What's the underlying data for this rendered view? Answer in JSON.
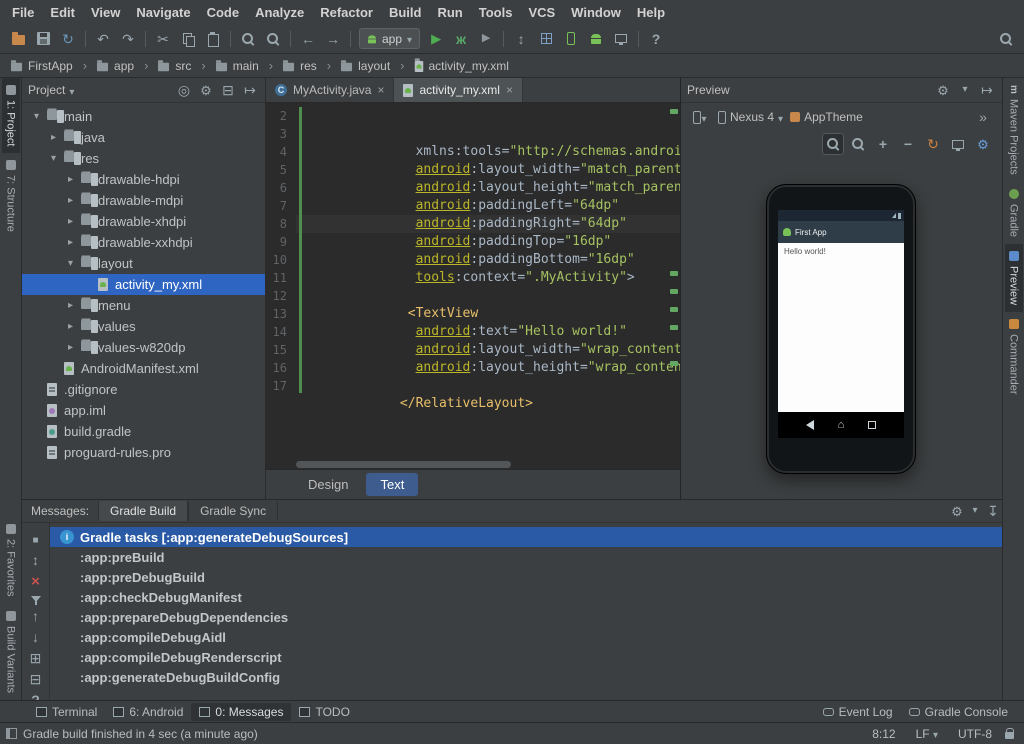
{
  "menubar": {
    "items": [
      "File",
      "Edit",
      "View",
      "Navigate",
      "Code",
      "Analyze",
      "Refactor",
      "Build",
      "Run",
      "Tools",
      "VCS",
      "Window",
      "Help"
    ]
  },
  "toolbar": {
    "run_config": "app"
  },
  "breadcrumbs": {
    "items": [
      {
        "label": "FirstApp",
        "icon": "bfolder"
      },
      {
        "label": "app",
        "icon": "bfolder"
      },
      {
        "label": "src",
        "icon": "bfolder"
      },
      {
        "label": "main",
        "icon": "bfolder"
      },
      {
        "label": "res",
        "icon": "bfolder"
      },
      {
        "label": "layout",
        "icon": "bfolder"
      },
      {
        "label": "activity_my.xml",
        "icon": "bxml"
      }
    ]
  },
  "left_strip": {
    "top": [
      {
        "label": "1: Project",
        "sel": "active"
      },
      {
        "label": "7: Structure"
      }
    ],
    "bottom": [
      {
        "label": "2: Favorites"
      },
      {
        "label": "Build Variants"
      }
    ]
  },
  "right_strip": {
    "items": [
      {
        "label": "Maven Projects",
        "icon": "maven"
      },
      {
        "label": "Gradle",
        "icon": "gradle"
      },
      {
        "label": "Preview",
        "icon": "preview",
        "sel": "active"
      },
      {
        "label": "Commander",
        "icon": "commander"
      }
    ]
  },
  "project": {
    "title": "Project",
    "tree": [
      {
        "label": "main",
        "ind": "ind1",
        "arrow": "▾",
        "icon": "folder"
      },
      {
        "label": "java",
        "ind": "ind2",
        "arrow": "▸",
        "icon": "folder"
      },
      {
        "label": "res",
        "ind": "ind2",
        "arrow": "▾",
        "icon": "folder"
      },
      {
        "label": "drawable-hdpi",
        "ind": "ind3",
        "arrow": "▸",
        "icon": "folder"
      },
      {
        "label": "drawable-mdpi",
        "ind": "ind3",
        "arrow": "▸",
        "icon": "folder"
      },
      {
        "label": "drawable-xhdpi",
        "ind": "ind3",
        "arrow": "▸",
        "icon": "folder"
      },
      {
        "label": "drawable-xxhdpi",
        "ind": "ind3",
        "arrow": "▸",
        "icon": "folder"
      },
      {
        "label": "layout",
        "ind": "ind3",
        "arrow": "▾",
        "icon": "folder"
      },
      {
        "label": "activity_my.xml",
        "ind": "ind4",
        "arrow": "",
        "icon": "xml",
        "sel": "selected"
      },
      {
        "label": "menu",
        "ind": "ind3",
        "arrow": "▸",
        "icon": "folder"
      },
      {
        "label": "values",
        "ind": "ind3",
        "arrow": "▸",
        "icon": "folder"
      },
      {
        "label": "values-w820dp",
        "ind": "ind3",
        "arrow": "▸",
        "icon": "folder"
      },
      {
        "label": "AndroidManifest.xml",
        "ind": "ind2",
        "arrow": "",
        "icon": "manifest"
      },
      {
        "label": ".gitignore",
        "ind": "ind1",
        "arrow": "",
        "icon": "text"
      },
      {
        "label": "app.iml",
        "ind": "ind1",
        "arrow": "",
        "icon": "iml"
      },
      {
        "label": "build.gradle",
        "ind": "ind1",
        "arrow": "",
        "icon": "gradle"
      },
      {
        "label": "proguard-rules.pro",
        "ind": "ind1",
        "arrow": "",
        "icon": "text"
      }
    ]
  },
  "editor": {
    "tabs": [
      {
        "label": "MyActivity.java",
        "icon": "java",
        "close": "×",
        "sel": ""
      },
      {
        "label": "activity_my.xml",
        "icon": "xml",
        "close": "×",
        "sel": "active"
      }
    ],
    "lines": [
      {
        "n": "2",
        "seg": [
          {
            "c": "p",
            "t": "  xmlns:tools="
          },
          {
            "c": "str",
            "t": "\"http://schemas.android.co"
          }
        ]
      },
      {
        "n": "3",
        "seg": [
          {
            "c": "p",
            "t": "  "
          },
          {
            "c": "ns",
            "t": "android"
          },
          {
            "c": "p",
            "t": ":layout_width="
          },
          {
            "c": "str",
            "t": "\"match_parent\""
          }
        ]
      },
      {
        "n": "4",
        "seg": [
          {
            "c": "p",
            "t": "  "
          },
          {
            "c": "ns",
            "t": "android"
          },
          {
            "c": "p",
            "t": ":layout_height="
          },
          {
            "c": "str",
            "t": "\"match_parent\""
          }
        ]
      },
      {
        "n": "5",
        "seg": [
          {
            "c": "p",
            "t": "  "
          },
          {
            "c": "ns",
            "t": "android"
          },
          {
            "c": "p",
            "t": ":paddingLeft="
          },
          {
            "c": "str",
            "t": "\"64dp\""
          }
        ]
      },
      {
        "n": "6",
        "seg": [
          {
            "c": "p",
            "t": "  "
          },
          {
            "c": "ns",
            "t": "android"
          },
          {
            "c": "p",
            "t": ":paddingRight="
          },
          {
            "c": "str",
            "t": "\"64dp\""
          }
        ]
      },
      {
        "n": "7",
        "seg": [
          {
            "c": "p",
            "t": "  "
          },
          {
            "c": "ns",
            "t": "android"
          },
          {
            "c": "p",
            "t": ":paddingTop="
          },
          {
            "c": "str",
            "t": "\"16dp\""
          }
        ]
      },
      {
        "n": "8",
        "cls": "current",
        "seg": [
          {
            "c": "p",
            "t": "  "
          },
          {
            "c": "ns",
            "t": "android"
          },
          {
            "c": "p",
            "t": ":paddingBottom="
          },
          {
            "c": "str",
            "t": "\"16dp\""
          }
        ]
      },
      {
        "n": "9",
        "seg": [
          {
            "c": "p",
            "t": "  "
          },
          {
            "c": "ns",
            "t": "tools"
          },
          {
            "c": "p",
            "t": ":context="
          },
          {
            "c": "str",
            "t": "\".MyActivity\""
          },
          {
            "c": "p",
            "t": ">"
          }
        ]
      },
      {
        "n": "10",
        "seg": []
      },
      {
        "n": "11",
        "seg": [
          {
            "c": "tag",
            "t": " <TextView"
          }
        ]
      },
      {
        "n": "12",
        "seg": [
          {
            "c": "p",
            "t": "  "
          },
          {
            "c": "ns",
            "t": "android"
          },
          {
            "c": "p",
            "t": ":text="
          },
          {
            "c": "str",
            "t": "\"Hello world!\""
          }
        ]
      },
      {
        "n": "13",
        "seg": [
          {
            "c": "p",
            "t": "  "
          },
          {
            "c": "ns",
            "t": "android"
          },
          {
            "c": "p",
            "t": ":layout_width="
          },
          {
            "c": "str",
            "t": "\"wrap_content\""
          }
        ]
      },
      {
        "n": "14",
        "seg": [
          {
            "c": "p",
            "t": "  "
          },
          {
            "c": "ns",
            "t": "android"
          },
          {
            "c": "p",
            "t": ":layout_height="
          },
          {
            "c": "str",
            "t": "\"wrap_conten"
          }
        ]
      },
      {
        "n": "15",
        "seg": []
      },
      {
        "n": "16",
        "seg": [
          {
            "c": "tag",
            "t": "</RelativeLayout>"
          }
        ]
      },
      {
        "n": "17",
        "seg": []
      }
    ],
    "bottom_tabs": [
      {
        "label": "Design",
        "sel": ""
      },
      {
        "label": "Text",
        "sel": "active"
      }
    ]
  },
  "preview": {
    "title": "Preview",
    "device": "Nexus 4",
    "theme": "AppTheme",
    "phone": {
      "app_title": "First App",
      "content": "Hello world!"
    }
  },
  "messages": {
    "label": "Messages:",
    "tabs": [
      {
        "label": "Gradle Build",
        "sel": "active"
      },
      {
        "label": "Gradle Sync",
        "sel": ""
      }
    ],
    "rows": [
      {
        "t": "Gradle tasks [:app:generateDebugSources]",
        "sel": "selected",
        "icon": "info"
      },
      {
        "t": ":app:preBuild"
      },
      {
        "t": ":app:preDebugBuild"
      },
      {
        "t": ":app:checkDebugManifest"
      },
      {
        "t": ":app:prepareDebugDependencies"
      },
      {
        "t": ":app:compileDebugAidl"
      },
      {
        "t": ":app:compileDebugRenderscript"
      },
      {
        "t": ":app:generateDebugBuildConfig"
      }
    ]
  },
  "bottom_bar": {
    "left": [
      {
        "label": "Terminal",
        "icon": "terminal"
      },
      {
        "label": "6: Android",
        "icon": "android"
      },
      {
        "label": "0: Messages",
        "icon": "messages",
        "sel": "active"
      },
      {
        "label": "TODO",
        "icon": "todo"
      }
    ],
    "right": [
      {
        "label": "Event Log",
        "icon": "eventlog"
      },
      {
        "label": "Gradle Console",
        "icon": "console"
      }
    ]
  },
  "status_bar": {
    "message": "Gradle build finished in 4 sec (a minute ago)",
    "position": "8:12",
    "line_sep": "LF",
    "encoding": "UTF-8"
  }
}
